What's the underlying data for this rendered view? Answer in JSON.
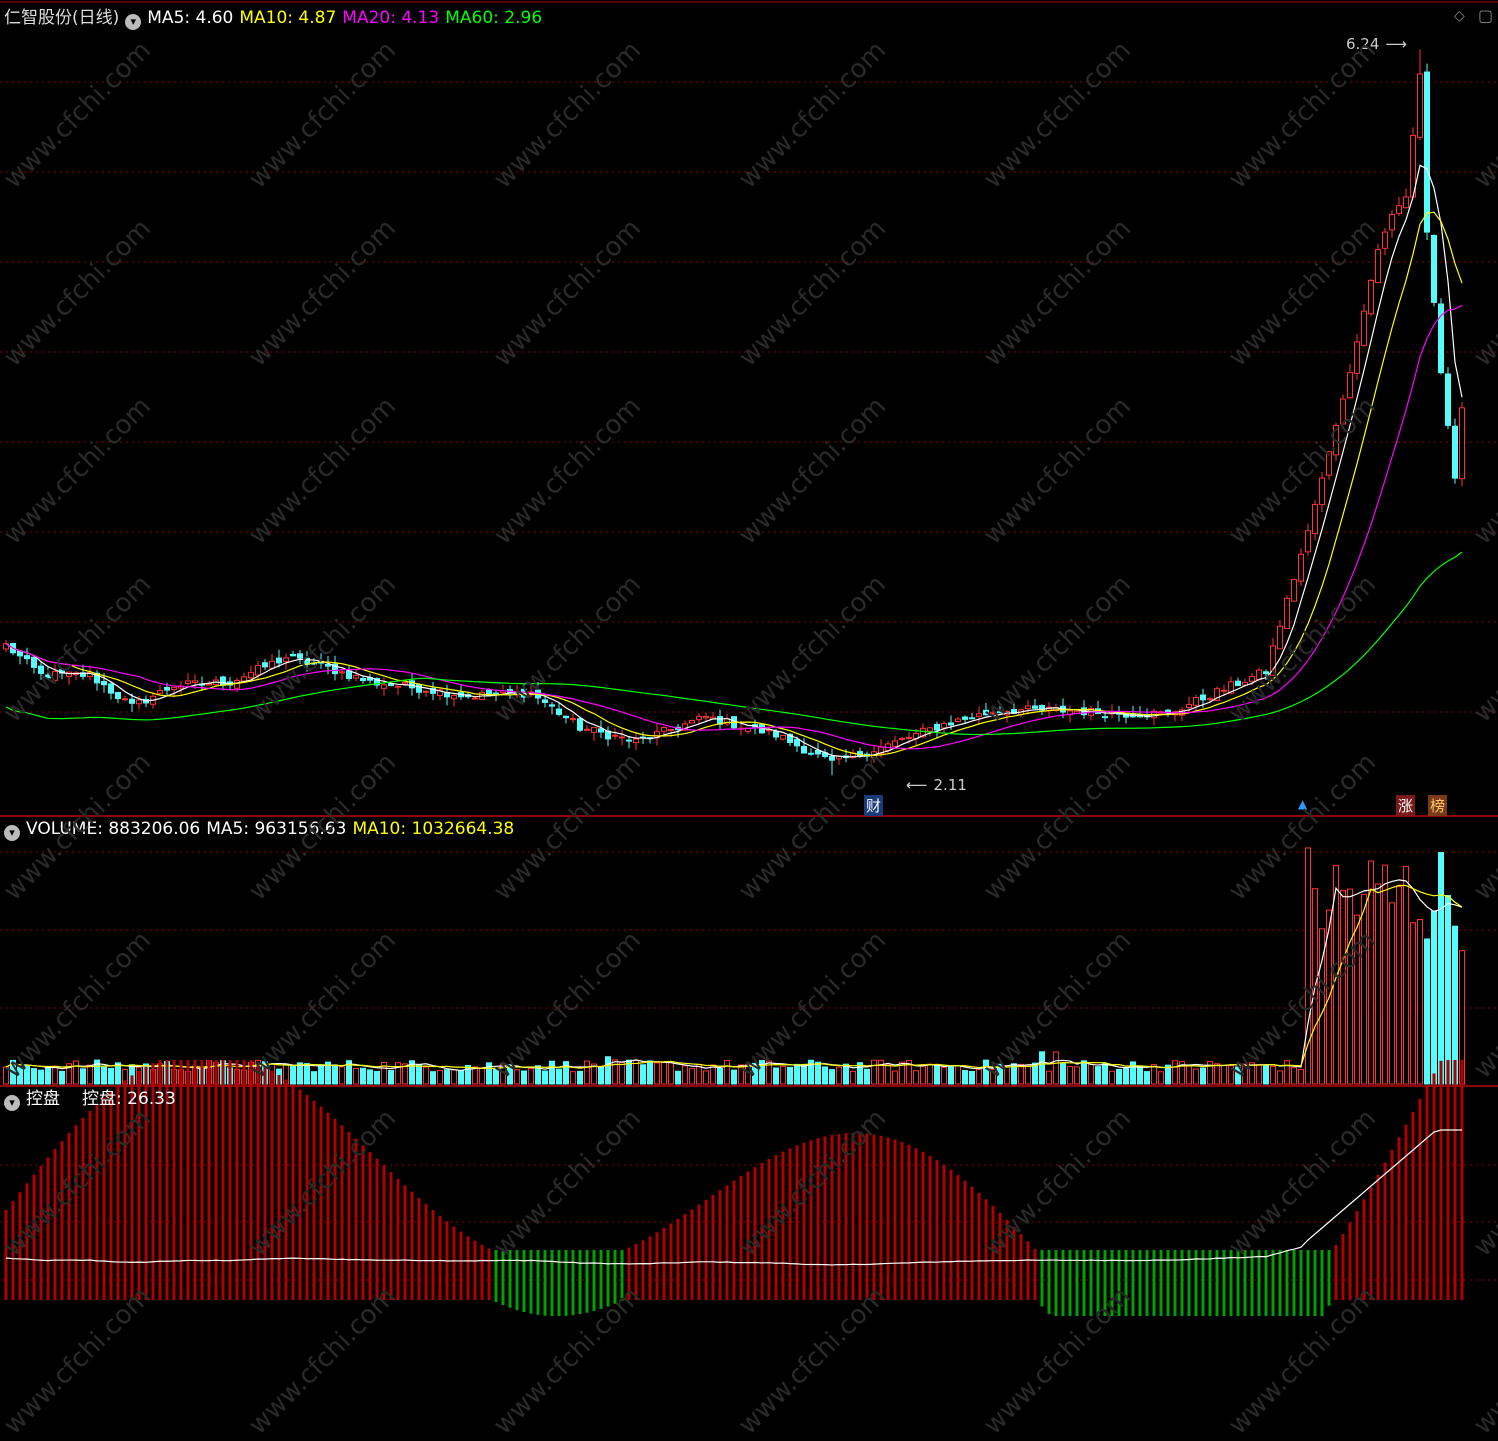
{
  "colors": {
    "up": "#ff3232",
    "down": "#54fcfc",
    "ma5": "#ffffff",
    "ma10": "#ffff00",
    "ma20": "#ff00ff",
    "ma60": "#00ff00",
    "grid": "#8b0000",
    "separator": "#c00000"
  },
  "header": {
    "title": "仁智股份(日线)",
    "ma5": "MA5: 4.60",
    "ma10": "MA10: 4.87",
    "ma20": "MA20: 4.13",
    "ma60": "MA60: 2.96"
  },
  "volume_header": {
    "label": "VOLUME: 883206.06",
    "ma5": "MA5: 963156.63",
    "ma10": "MA10: 1032664.38"
  },
  "control_header": {
    "label": "控盘",
    "value": "控盘: 26.33"
  },
  "annotations": {
    "high": "6.24",
    "low": "2.11",
    "event_cai": "财",
    "event_zhang": "涨",
    "event_bang": "榜"
  },
  "watermark": "www.cfchi.com",
  "chart_data": [
    {
      "type": "candlestick",
      "title": "仁智股份(日线)",
      "y_high_label": 6.24,
      "y_low_label": 2.11,
      "anchors": [
        [
          0,
          2.85
        ],
        [
          5,
          2.68
        ],
        [
          12,
          2.68
        ],
        [
          18,
          2.5
        ],
        [
          24,
          2.62
        ],
        [
          32,
          2.64
        ],
        [
          40,
          2.78
        ],
        [
          46,
          2.72
        ],
        [
          52,
          2.64
        ],
        [
          60,
          2.6
        ],
        [
          66,
          2.56
        ],
        [
          75,
          2.58
        ],
        [
          82,
          2.38
        ],
        [
          90,
          2.3
        ],
        [
          100,
          2.44
        ],
        [
          110,
          2.34
        ],
        [
          118,
          2.18
        ],
        [
          126,
          2.28
        ],
        [
          134,
          2.4
        ],
        [
          142,
          2.48
        ],
        [
          150,
          2.48
        ],
        [
          160,
          2.46
        ],
        [
          166,
          2.46
        ],
        [
          174,
          2.6
        ],
        [
          180,
          2.7
        ],
        [
          186,
          3.5
        ],
        [
          192,
          4.4
        ],
        [
          196,
          5.1
        ],
        [
          198,
          5.3
        ],
        [
          200,
          5.4
        ],
        [
          202,
          6.1
        ],
        [
          203,
          5.2
        ],
        [
          204,
          4.8
        ],
        [
          205,
          4.4
        ],
        [
          206,
          4.1
        ],
        [
          207,
          3.8
        ],
        [
          208,
          4.2
        ]
      ],
      "series": [
        {
          "name": "MA5"
        },
        {
          "name": "MA10"
        },
        {
          "name": "MA20"
        },
        {
          "name": "MA60"
        }
      ]
    },
    {
      "type": "bar",
      "title": "VOLUME",
      "values_last": {
        "volume": 883206.06,
        "ma5": 963156.63,
        "ma10": 1032664.38
      }
    },
    {
      "type": "bar",
      "title": "控盘",
      "values_last": {
        "控盘": 26.33
      }
    }
  ]
}
